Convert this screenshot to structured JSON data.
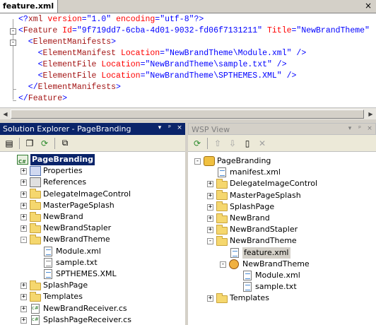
{
  "editor": {
    "tab_title": "feature.xml",
    "close_glyph": "×",
    "lines": [
      {
        "parts": [
          [
            "b",
            "<?"
          ],
          [
            "t",
            "xml"
          ],
          [
            "a",
            " version"
          ],
          [
            "b",
            "="
          ],
          [
            "v",
            "\"1.0\""
          ],
          [
            "a",
            " encoding"
          ],
          [
            "b",
            "="
          ],
          [
            "v",
            "\"utf-8\""
          ],
          [
            "b",
            "?>"
          ]
        ]
      },
      {
        "parts": [
          [
            "b",
            "<"
          ],
          [
            "t",
            "Feature"
          ],
          [
            "a",
            " Id"
          ],
          [
            "b",
            "="
          ],
          [
            "v",
            "\"9f719dd7-6cba-4d01-9032-fd06f7131211\""
          ],
          [
            "a",
            " Title"
          ],
          [
            "b",
            "="
          ],
          [
            "v",
            "\"NewBrandTheme\""
          ]
        ]
      },
      {
        "parts": [
          [
            "b",
            "  <"
          ],
          [
            "t",
            "ElementManifests"
          ],
          [
            "b",
            ">"
          ]
        ]
      },
      {
        "parts": [
          [
            "b",
            "    <"
          ],
          [
            "t",
            "ElementManifest"
          ],
          [
            "a",
            " Location"
          ],
          [
            "b",
            "="
          ],
          [
            "v",
            "\"NewBrandTheme\\Module.xml\""
          ],
          [
            "b",
            " />"
          ]
        ]
      },
      {
        "parts": [
          [
            "b",
            "    <"
          ],
          [
            "t",
            "ElementFile"
          ],
          [
            "a",
            " Location"
          ],
          [
            "b",
            "="
          ],
          [
            "v",
            "\"NewBrandTheme\\sample.txt\""
          ],
          [
            "b",
            " />"
          ]
        ]
      },
      {
        "parts": [
          [
            "b",
            "    <"
          ],
          [
            "t",
            "ElementFile"
          ],
          [
            "a",
            " Location"
          ],
          [
            "b",
            "="
          ],
          [
            "v",
            "\"NewBrandTheme\\SPTHEMES.XML\""
          ],
          [
            "b",
            " />"
          ]
        ]
      },
      {
        "parts": [
          [
            "b",
            "  </"
          ],
          [
            "t",
            "ElementManifests"
          ],
          [
            "b",
            ">"
          ]
        ]
      },
      {
        "parts": [
          [
            "b",
            "</"
          ],
          [
            "t",
            "Feature"
          ],
          [
            "b",
            ">"
          ]
        ]
      }
    ]
  },
  "solution_explorer": {
    "title": "Solution Explorer - PageBranding",
    "title_buttons": [
      "▾",
      "ᵖ",
      "×"
    ],
    "items": [
      {
        "label": "PageBranding",
        "icon": "project-icon",
        "level": 0,
        "exp": "",
        "selected": true
      },
      {
        "label": "Properties",
        "icon": "properties-icon",
        "level": 1,
        "exp": "+"
      },
      {
        "label": "References",
        "icon": "references-icon",
        "level": 1,
        "exp": "+"
      },
      {
        "label": "DelegateImageControl",
        "icon": "folder-icon",
        "level": 1,
        "exp": "+"
      },
      {
        "label": "MasterPageSplash",
        "icon": "folder-icon",
        "level": 1,
        "exp": "+"
      },
      {
        "label": "NewBrand",
        "icon": "folder-icon",
        "level": 1,
        "exp": "+"
      },
      {
        "label": "NewBrandStapler",
        "icon": "folder-icon",
        "level": 1,
        "exp": "+"
      },
      {
        "label": "NewBrandTheme",
        "icon": "folder-icon",
        "level": 1,
        "exp": "-"
      },
      {
        "label": "Module.xml",
        "icon": "xml-file-icon",
        "level": 2,
        "exp": ""
      },
      {
        "label": "sample.txt",
        "icon": "text-file-icon",
        "level": 2,
        "exp": ""
      },
      {
        "label": "SPTHEMES.XML",
        "icon": "xml-file-icon",
        "level": 2,
        "exp": ""
      },
      {
        "label": "SplashPage",
        "icon": "folder-icon",
        "level": 1,
        "exp": "+"
      },
      {
        "label": "Templates",
        "icon": "folder-icon",
        "level": 1,
        "exp": "+"
      },
      {
        "label": "NewBrandReceiver.cs",
        "icon": "cs-file-icon",
        "level": 1,
        "exp": "+"
      },
      {
        "label": "SplashPageReceiver.cs",
        "icon": "cs-file-icon",
        "level": 1,
        "exp": "+"
      }
    ]
  },
  "wsp_view": {
    "title": "WSP View",
    "title_buttons": [
      "▾",
      "ᵖ",
      "×"
    ],
    "items": [
      {
        "label": "PageBranding",
        "icon": "package-icon",
        "level": 0,
        "exp": "-"
      },
      {
        "label": "manifest.xml",
        "icon": "xml-file-icon",
        "level": 1,
        "exp": ""
      },
      {
        "label": "DelegateImageControl",
        "icon": "folder-icon",
        "level": 1,
        "exp": "+"
      },
      {
        "label": "MasterPageSplash",
        "icon": "folder-icon",
        "level": 1,
        "exp": "+"
      },
      {
        "label": "SplashPage",
        "icon": "folder-icon",
        "level": 1,
        "exp": "+"
      },
      {
        "label": "NewBrand",
        "icon": "folder-icon",
        "level": 1,
        "exp": "+"
      },
      {
        "label": "NewBrandStapler",
        "icon": "folder-icon",
        "level": 1,
        "exp": "+"
      },
      {
        "label": "NewBrandTheme",
        "icon": "folder-icon",
        "level": 1,
        "exp": "-"
      },
      {
        "label": "feature.xml",
        "icon": "xml-file-icon",
        "level": 2,
        "exp": "",
        "highlighted": true
      },
      {
        "label": "NewBrandTheme",
        "icon": "feature-icon",
        "level": 2,
        "exp": "-"
      },
      {
        "label": "Module.xml",
        "icon": "xml-file-icon",
        "level": 3,
        "exp": ""
      },
      {
        "label": "sample.txt",
        "icon": "xml-file-icon",
        "level": 3,
        "exp": ""
      },
      {
        "label": "Templates",
        "icon": "folder-icon",
        "level": 1,
        "exp": "+"
      }
    ]
  }
}
